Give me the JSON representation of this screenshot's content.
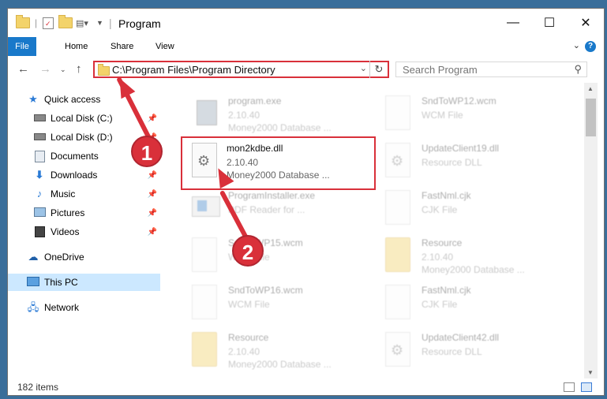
{
  "window": {
    "title": "Program",
    "controls": {
      "minimize": "—",
      "maximize": "☐",
      "close": "✕"
    }
  },
  "ribbon": {
    "tabs": [
      "File",
      "Home",
      "Share",
      "View"
    ],
    "help": "?"
  },
  "nav": {
    "address": "C:\\Program Files\\Program Directory",
    "search_placeholder": "Search Program"
  },
  "sidebar": {
    "items": [
      {
        "label": "Quick access",
        "icon": "star-icon"
      },
      {
        "label": "Local Disk (C:)",
        "icon": "drive-icon"
      },
      {
        "label": "Local Disk (D:)",
        "icon": "drive-icon"
      },
      {
        "label": "Documents",
        "icon": "documents-icon"
      },
      {
        "label": "Downloads",
        "icon": "download-icon"
      },
      {
        "label": "Music",
        "icon": "music-icon"
      },
      {
        "label": "Pictures",
        "icon": "pictures-icon"
      },
      {
        "label": "Videos",
        "icon": "videos-icon"
      },
      {
        "label": "OneDrive",
        "icon": "cloud-icon"
      },
      {
        "label": "This PC",
        "icon": "computer-icon"
      },
      {
        "label": "Network",
        "icon": "network-icon"
      }
    ]
  },
  "files": [
    {
      "name": "program.exe",
      "line2": "2.10.40",
      "line3": "Money2000 Database ..."
    },
    {
      "name": "SndToWP12.wcm",
      "line2": "WCM File",
      "line3": ""
    },
    {
      "name": "mon2kdbe.dll",
      "line2": "2.10.40",
      "line3": "Money2000 Database ..."
    },
    {
      "name": "UpdateClient19.dll",
      "line2": "Resource DLL",
      "line3": ""
    },
    {
      "name": "ProgramInstaller.exe",
      "line2": "PDF Reader for ...",
      "line3": ""
    },
    {
      "name": "FastNml.cjk",
      "line2": "CJK File",
      "line3": ""
    },
    {
      "name": "SndToWP15.wcm",
      "line2": "WCM File",
      "line3": ""
    },
    {
      "name": "Resource",
      "line2": "2.10.40",
      "line3": "Money2000 Database ..."
    },
    {
      "name": "SndToWP16.wcm",
      "line2": "WCM File",
      "line3": ""
    },
    {
      "name": "FastNml.cjk",
      "line2": "CJK File",
      "line3": ""
    },
    {
      "name": "Resource",
      "line2": "2.10.40",
      "line3": "Money2000 Database ..."
    },
    {
      "name": "UpdateClient42.dll",
      "line2": "Resource DLL",
      "line3": ""
    }
  ],
  "status": {
    "items": "182 items"
  },
  "annotations": {
    "badge1": "1",
    "badge2": "2"
  },
  "colors": {
    "accent": "#1979ca",
    "annotation_red": "#d9303a",
    "selected_bg": "#cce8ff"
  }
}
